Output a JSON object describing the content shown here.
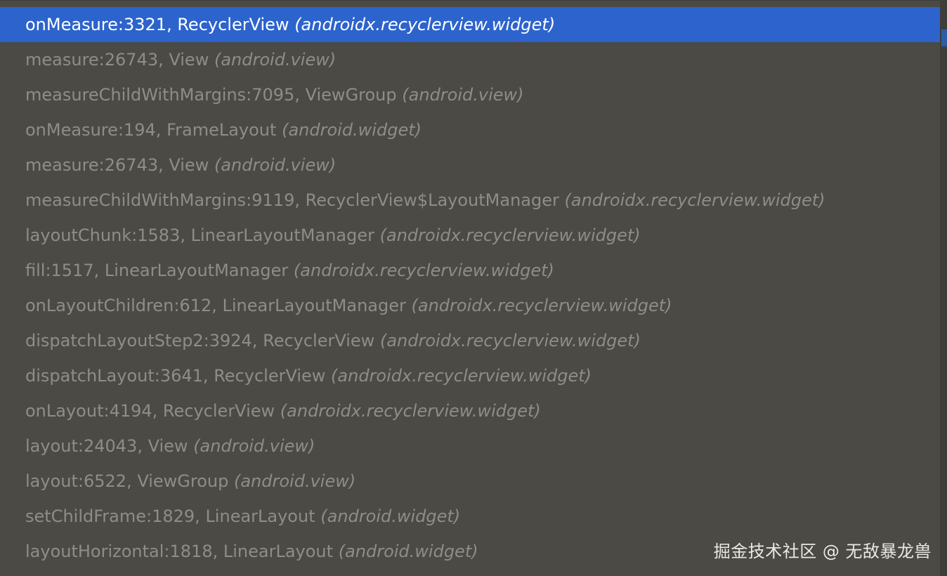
{
  "frames": [
    {
      "method": "onMeasure:3321",
      "cls": "RecyclerView",
      "pkg": "(androidx.recyclerview.widget)",
      "selected": true
    },
    {
      "method": "measure:26743",
      "cls": "View",
      "pkg": "(android.view)"
    },
    {
      "method": "measureChildWithMargins:7095",
      "cls": "ViewGroup",
      "pkg": "(android.view)"
    },
    {
      "method": "onMeasure:194",
      "cls": "FrameLayout",
      "pkg": "(android.widget)"
    },
    {
      "method": "measure:26743",
      "cls": "View",
      "pkg": "(android.view)"
    },
    {
      "method": "measureChildWithMargins:9119",
      "cls": "RecyclerView$LayoutManager",
      "pkg": "(androidx.recyclerview.widget)"
    },
    {
      "method": "layoutChunk:1583",
      "cls": "LinearLayoutManager",
      "pkg": "(androidx.recyclerview.widget)"
    },
    {
      "method": "fill:1517",
      "cls": "LinearLayoutManager",
      "pkg": "(androidx.recyclerview.widget)"
    },
    {
      "method": "onLayoutChildren:612",
      "cls": "LinearLayoutManager",
      "pkg": "(androidx.recyclerview.widget)"
    },
    {
      "method": "dispatchLayoutStep2:3924",
      "cls": "RecyclerView",
      "pkg": "(androidx.recyclerview.widget)"
    },
    {
      "method": "dispatchLayout:3641",
      "cls": "RecyclerView",
      "pkg": "(androidx.recyclerview.widget)"
    },
    {
      "method": "onLayout:4194",
      "cls": "RecyclerView",
      "pkg": "(androidx.recyclerview.widget)"
    },
    {
      "method": "layout:24043",
      "cls": "View",
      "pkg": "(android.view)"
    },
    {
      "method": "layout:6522",
      "cls": "ViewGroup",
      "pkg": "(android.view)"
    },
    {
      "method": "setChildFrame:1829",
      "cls": "LinearLayout",
      "pkg": "(android.widget)"
    },
    {
      "method": "layoutHorizontal:1818",
      "cls": "LinearLayout",
      "pkg": "(android.widget)"
    }
  ],
  "watermark": "掘金技术社区 @ 无敌暴龙兽",
  "colors": {
    "background": "#4b4a44",
    "selected_background": "#2d63cc",
    "selected_text": "#ffffff",
    "text": "#8e8d87"
  }
}
